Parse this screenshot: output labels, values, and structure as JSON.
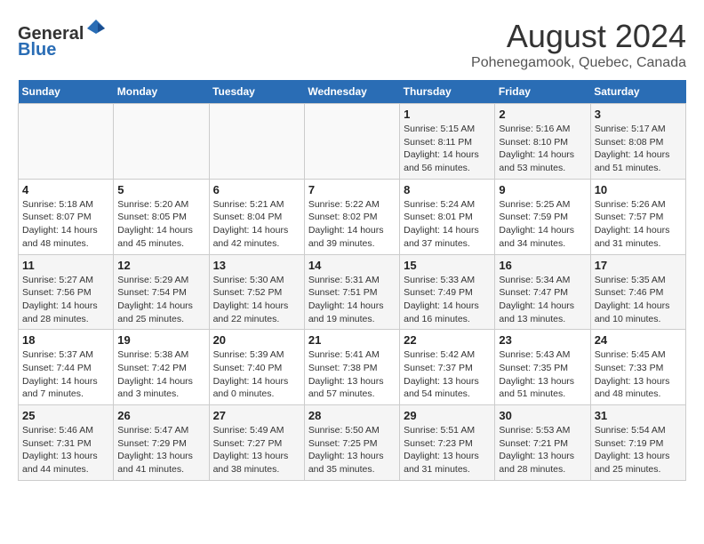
{
  "header": {
    "logo_line1": "General",
    "logo_line2": "Blue",
    "title": "August 2024",
    "subtitle": "Pohenegamook, Quebec, Canada"
  },
  "days_of_week": [
    "Sunday",
    "Monday",
    "Tuesday",
    "Wednesday",
    "Thursday",
    "Friday",
    "Saturday"
  ],
  "weeks": [
    [
      {
        "day": "",
        "info": ""
      },
      {
        "day": "",
        "info": ""
      },
      {
        "day": "",
        "info": ""
      },
      {
        "day": "",
        "info": ""
      },
      {
        "day": "1",
        "info": "Sunrise: 5:15 AM\nSunset: 8:11 PM\nDaylight: 14 hours\nand 56 minutes."
      },
      {
        "day": "2",
        "info": "Sunrise: 5:16 AM\nSunset: 8:10 PM\nDaylight: 14 hours\nand 53 minutes."
      },
      {
        "day": "3",
        "info": "Sunrise: 5:17 AM\nSunset: 8:08 PM\nDaylight: 14 hours\nand 51 minutes."
      }
    ],
    [
      {
        "day": "4",
        "info": "Sunrise: 5:18 AM\nSunset: 8:07 PM\nDaylight: 14 hours\nand 48 minutes."
      },
      {
        "day": "5",
        "info": "Sunrise: 5:20 AM\nSunset: 8:05 PM\nDaylight: 14 hours\nand 45 minutes."
      },
      {
        "day": "6",
        "info": "Sunrise: 5:21 AM\nSunset: 8:04 PM\nDaylight: 14 hours\nand 42 minutes."
      },
      {
        "day": "7",
        "info": "Sunrise: 5:22 AM\nSunset: 8:02 PM\nDaylight: 14 hours\nand 39 minutes."
      },
      {
        "day": "8",
        "info": "Sunrise: 5:24 AM\nSunset: 8:01 PM\nDaylight: 14 hours\nand 37 minutes."
      },
      {
        "day": "9",
        "info": "Sunrise: 5:25 AM\nSunset: 7:59 PM\nDaylight: 14 hours\nand 34 minutes."
      },
      {
        "day": "10",
        "info": "Sunrise: 5:26 AM\nSunset: 7:57 PM\nDaylight: 14 hours\nand 31 minutes."
      }
    ],
    [
      {
        "day": "11",
        "info": "Sunrise: 5:27 AM\nSunset: 7:56 PM\nDaylight: 14 hours\nand 28 minutes."
      },
      {
        "day": "12",
        "info": "Sunrise: 5:29 AM\nSunset: 7:54 PM\nDaylight: 14 hours\nand 25 minutes."
      },
      {
        "day": "13",
        "info": "Sunrise: 5:30 AM\nSunset: 7:52 PM\nDaylight: 14 hours\nand 22 minutes."
      },
      {
        "day": "14",
        "info": "Sunrise: 5:31 AM\nSunset: 7:51 PM\nDaylight: 14 hours\nand 19 minutes."
      },
      {
        "day": "15",
        "info": "Sunrise: 5:33 AM\nSunset: 7:49 PM\nDaylight: 14 hours\nand 16 minutes."
      },
      {
        "day": "16",
        "info": "Sunrise: 5:34 AM\nSunset: 7:47 PM\nDaylight: 14 hours\nand 13 minutes."
      },
      {
        "day": "17",
        "info": "Sunrise: 5:35 AM\nSunset: 7:46 PM\nDaylight: 14 hours\nand 10 minutes."
      }
    ],
    [
      {
        "day": "18",
        "info": "Sunrise: 5:37 AM\nSunset: 7:44 PM\nDaylight: 14 hours\nand 7 minutes."
      },
      {
        "day": "19",
        "info": "Sunrise: 5:38 AM\nSunset: 7:42 PM\nDaylight: 14 hours\nand 3 minutes."
      },
      {
        "day": "20",
        "info": "Sunrise: 5:39 AM\nSunset: 7:40 PM\nDaylight: 14 hours\nand 0 minutes."
      },
      {
        "day": "21",
        "info": "Sunrise: 5:41 AM\nSunset: 7:38 PM\nDaylight: 13 hours\nand 57 minutes."
      },
      {
        "day": "22",
        "info": "Sunrise: 5:42 AM\nSunset: 7:37 PM\nDaylight: 13 hours\nand 54 minutes."
      },
      {
        "day": "23",
        "info": "Sunrise: 5:43 AM\nSunset: 7:35 PM\nDaylight: 13 hours\nand 51 minutes."
      },
      {
        "day": "24",
        "info": "Sunrise: 5:45 AM\nSunset: 7:33 PM\nDaylight: 13 hours\nand 48 minutes."
      }
    ],
    [
      {
        "day": "25",
        "info": "Sunrise: 5:46 AM\nSunset: 7:31 PM\nDaylight: 13 hours\nand 44 minutes."
      },
      {
        "day": "26",
        "info": "Sunrise: 5:47 AM\nSunset: 7:29 PM\nDaylight: 13 hours\nand 41 minutes."
      },
      {
        "day": "27",
        "info": "Sunrise: 5:49 AM\nSunset: 7:27 PM\nDaylight: 13 hours\nand 38 minutes."
      },
      {
        "day": "28",
        "info": "Sunrise: 5:50 AM\nSunset: 7:25 PM\nDaylight: 13 hours\nand 35 minutes."
      },
      {
        "day": "29",
        "info": "Sunrise: 5:51 AM\nSunset: 7:23 PM\nDaylight: 13 hours\nand 31 minutes."
      },
      {
        "day": "30",
        "info": "Sunrise: 5:53 AM\nSunset: 7:21 PM\nDaylight: 13 hours\nand 28 minutes."
      },
      {
        "day": "31",
        "info": "Sunrise: 5:54 AM\nSunset: 7:19 PM\nDaylight: 13 hours\nand 25 minutes."
      }
    ]
  ]
}
